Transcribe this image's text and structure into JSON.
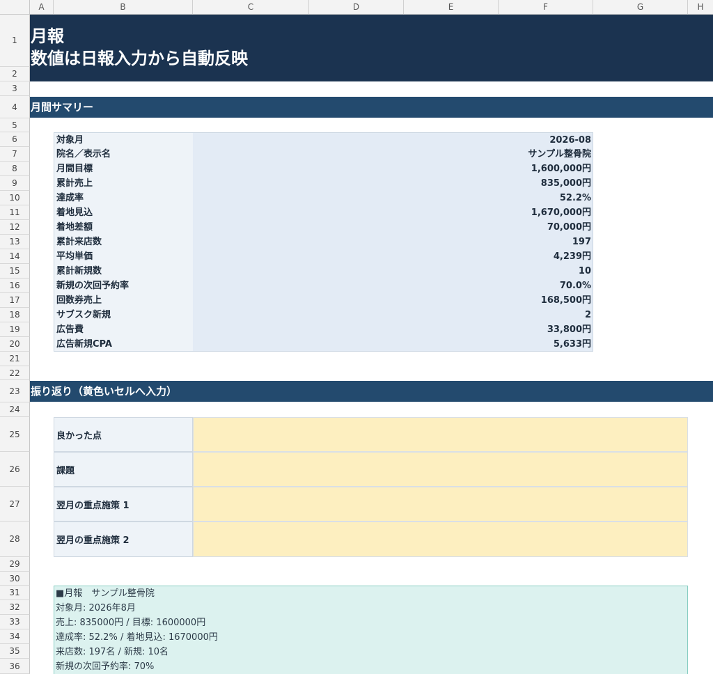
{
  "columns": [
    "A",
    "B",
    "C",
    "D",
    "E",
    "F",
    "G",
    "H"
  ],
  "rows": [
    "1",
    "2",
    "3",
    "4",
    "5",
    "6",
    "7",
    "8",
    "9",
    "10",
    "11",
    "12",
    "13",
    "14",
    "15",
    "16",
    "17",
    "18",
    "19",
    "20",
    "21",
    "22",
    "23",
    "24",
    "25",
    "26",
    "27",
    "28",
    "29",
    "30",
    "31",
    "32",
    "33",
    "34",
    "35",
    "36"
  ],
  "title": {
    "line1": "月報",
    "line2": "数値は日報入力から自動反映"
  },
  "summary": {
    "heading": "月間サマリー",
    "items": [
      {
        "label": "対象月",
        "value": "2026-08"
      },
      {
        "label": "院名／表示名",
        "value": "サンプル整骨院"
      },
      {
        "label": "月間目標",
        "value": "1,600,000円"
      },
      {
        "label": "累計売上",
        "value": "835,000円"
      },
      {
        "label": "達成率",
        "value": "52.2%"
      },
      {
        "label": "着地見込",
        "value": "1,670,000円"
      },
      {
        "label": "着地差額",
        "value": "70,000円"
      },
      {
        "label": "累計来店数",
        "value": "197"
      },
      {
        "label": "平均単価",
        "value": "4,239円"
      },
      {
        "label": "累計新規数",
        "value": "10"
      },
      {
        "label": "新規の次回予約率",
        "value": "70.0%"
      },
      {
        "label": "回数券売上",
        "value": "168,500円"
      },
      {
        "label": "サブスク新規",
        "value": "2"
      },
      {
        "label": "広告費",
        "value": "33,800円"
      },
      {
        "label": "広告新規CPA",
        "value": "5,633円"
      }
    ]
  },
  "reflection": {
    "heading": "振り返り（黄色いセルへ入力）",
    "items": [
      {
        "label": "良かった点",
        "value": ""
      },
      {
        "label": "課題",
        "value": ""
      },
      {
        "label": "翌月の重点施策 1",
        "value": ""
      },
      {
        "label": "翌月の重点施策 2",
        "value": ""
      }
    ]
  },
  "memo": {
    "lines": [
      "■月報　サンプル整骨院",
      "対象月: 2026年8月",
      "売上: 835000円 / 目標: 1600000円",
      "達成率: 52.2% / 着地見込: 1670000円",
      "来店数: 197名 / 新規: 10名",
      "新規の次回予約率: 70%"
    ]
  }
}
